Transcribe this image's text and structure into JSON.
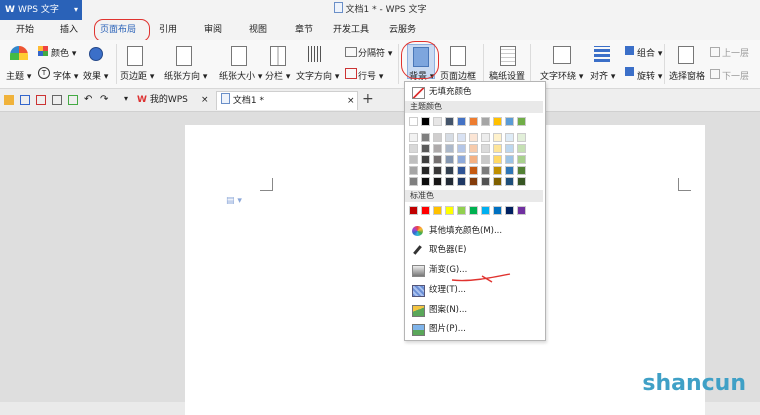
{
  "app": {
    "name": "WPS 文字",
    "window_title": "文档1 * - WPS 文字"
  },
  "menu": {
    "tabs": [
      "开始",
      "插入",
      "页面布局",
      "引用",
      "审阅",
      "视图",
      "章节",
      "开发工具",
      "云服务"
    ],
    "active": "页面布局"
  },
  "ribbon": {
    "theme": "主题",
    "colors": "颜色",
    "fonts": "字体",
    "effects": "效果",
    "margins": "页边距",
    "orientation": "纸张方向",
    "size": "纸张大小",
    "columns": "分栏",
    "text_direction": "文字方向",
    "separator": "分隔符",
    "line_numbers": "行号",
    "background": "背景",
    "page_border": "页面边框",
    "paper_setup": "稿纸设置",
    "wrap": "文字环绕",
    "align": "对齐",
    "rotate": "旋转",
    "group": "组合",
    "selection_pane": "选择窗格",
    "prev": "上一层",
    "next": "下一层"
  },
  "doc_tabs": {
    "home": "我的WPS",
    "doc": "文档1 *"
  },
  "dropdown": {
    "no_fill": "无填充颜色",
    "theme_header": "主题颜色",
    "standard_header": "标准色",
    "more_colors": "其他填充颜色(M)...",
    "picker": "取色器(E)",
    "gradient": "渐变(G)...",
    "texture": "纹理(T)...",
    "pattern": "图案(N)...",
    "picture": "图片(P)...",
    "theme_top_row": [
      "#ffffff",
      "#000000",
      "#e7e6e6",
      "#44546a",
      "#4472c4",
      "#ed7d31",
      "#a5a5a5",
      "#ffc000",
      "#5b9bd5",
      "#70ad47"
    ],
    "theme_shades": [
      [
        "#f2f2f2",
        "#7f7f7f",
        "#d0cece",
        "#d6dce4",
        "#d9e2f3",
        "#fbe5d5",
        "#ededed",
        "#fff2cc",
        "#deebf6",
        "#e2efd9"
      ],
      [
        "#d8d8d8",
        "#595959",
        "#aeaaaa",
        "#adb9ca",
        "#b4c6e7",
        "#f7cbac",
        "#dbdbdb",
        "#fee599",
        "#bdd7ee",
        "#c5e0b3"
      ],
      [
        "#bfbfbf",
        "#3f3f3f",
        "#757070",
        "#8496b0",
        "#8eaadb",
        "#f4b183",
        "#c9c9c9",
        "#ffd966",
        "#9cc3e5",
        "#a8d08d"
      ],
      [
        "#a5a5a5",
        "#262626",
        "#3a3838",
        "#323f4f",
        "#2f5496",
        "#c55a11",
        "#7b7b7b",
        "#bf8f00",
        "#2e75b5",
        "#538135"
      ],
      [
        "#7f7f7f",
        "#0c0c0c",
        "#171616",
        "#222a35",
        "#1f3864",
        "#833c0b",
        "#525252",
        "#7f6000",
        "#1e4e79",
        "#375623"
      ]
    ],
    "standard_colors": [
      "#c00000",
      "#ff0000",
      "#ffc000",
      "#ffff00",
      "#92d050",
      "#00b050",
      "#00b0f0",
      "#0070c0",
      "#002060",
      "#7030a0"
    ]
  },
  "watermark": "shancun",
  "colors": {
    "accent": "#2a62b8",
    "annotation": "#e0332f"
  }
}
